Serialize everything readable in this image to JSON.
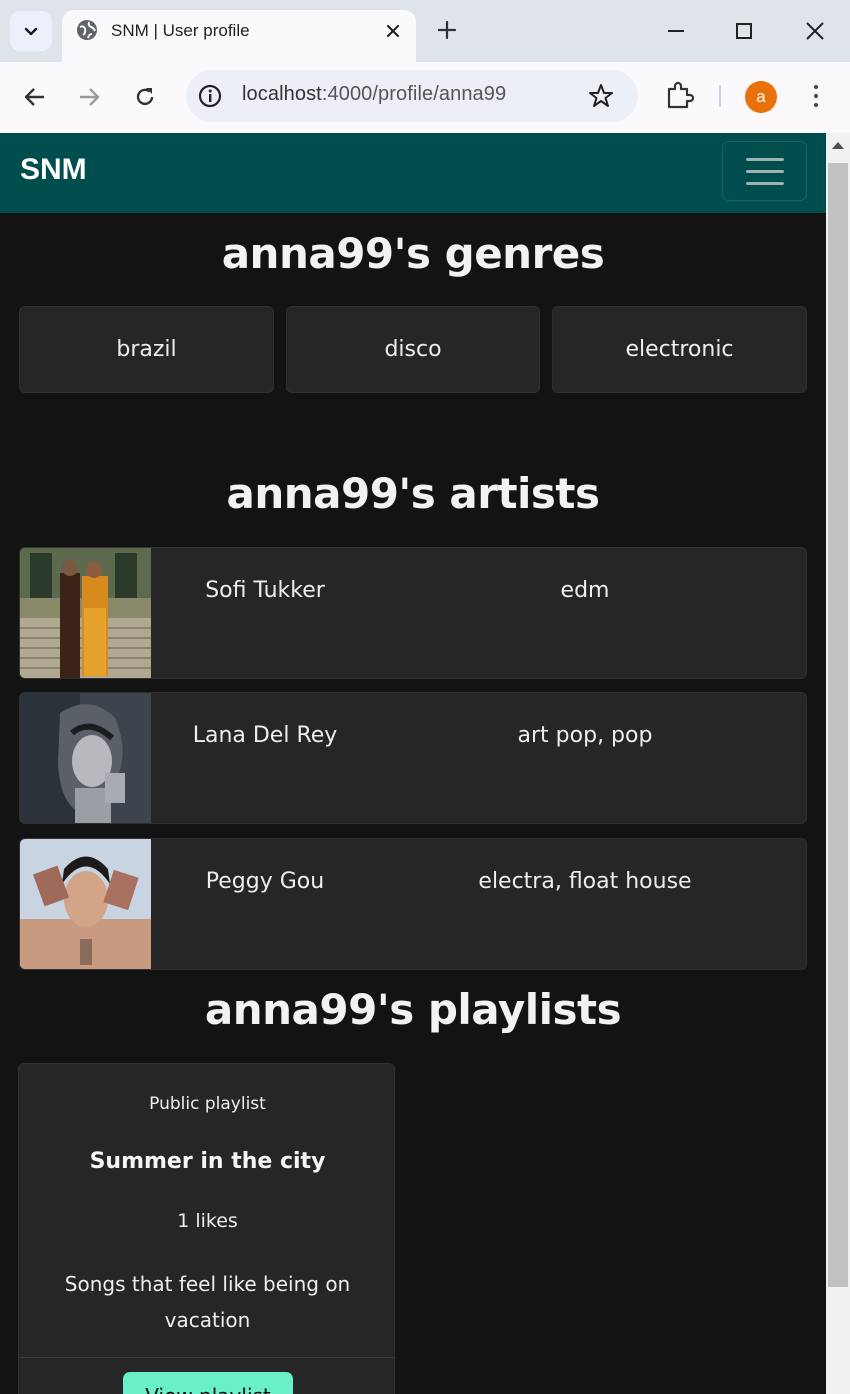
{
  "browser": {
    "tab_title": "SNM | User profile",
    "url_host": "localhost",
    "url_rest": ":4000/profile/anna99",
    "avatar_initial": "a",
    "icons": [
      "tab-search-icon",
      "globe-icon",
      "close-icon",
      "plus-icon",
      "minimize-icon",
      "maximize-icon",
      "close-window-icon",
      "back-icon",
      "forward-icon",
      "reload-icon",
      "info-icon",
      "star-icon",
      "extensions-icon",
      "more-icon"
    ]
  },
  "navbar": {
    "brand": "SNM",
    "bg_color": "#004d4d"
  },
  "genres": {
    "heading": "anna99's genres",
    "items": [
      "brazil",
      "disco",
      "electronic"
    ]
  },
  "artists": {
    "heading": "anna99's artists",
    "items": [
      {
        "name": "Sofi Tukker",
        "genres": "edm"
      },
      {
        "name": "Lana Del Rey",
        "genres": "art pop, pop"
      },
      {
        "name": "Peggy Gou",
        "genres": "electra, float house"
      }
    ]
  },
  "playlists": {
    "heading": "anna99's playlists",
    "items": [
      {
        "type": "Public playlist",
        "title": "Summer in the city",
        "likes": "1 likes",
        "description": "Songs that feel like being on vacation",
        "button_label": "View playlist"
      }
    ]
  },
  "colors": {
    "page_bg": "#131313",
    "card_bg": "#262626",
    "button_accent": "#69f0c8"
  }
}
